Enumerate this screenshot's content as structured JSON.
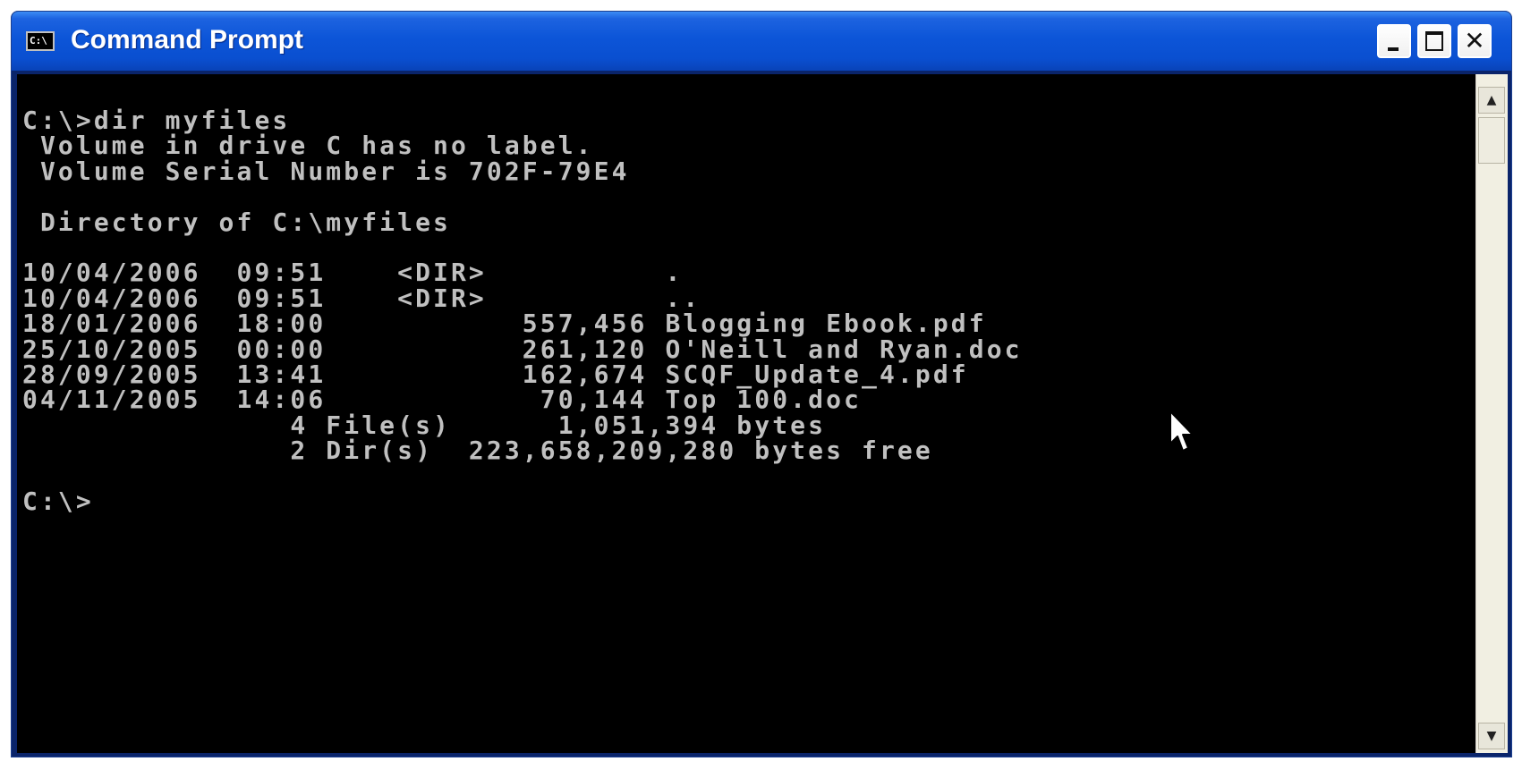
{
  "window": {
    "title": "Command Prompt",
    "icon_text": "C:\\"
  },
  "console": {
    "lines": [
      "C:\\>dir myfiles",
      " Volume in drive C has no label.",
      " Volume Serial Number is 702F-79E4",
      "",
      " Directory of C:\\myfiles",
      "",
      "10/04/2006  09:51    <DIR>          .",
      "10/04/2006  09:51    <DIR>          ..",
      "18/01/2006  18:00           557,456 Blogging Ebook.pdf",
      "25/10/2005  00:00           261,120 O'Neill and Ryan.doc",
      "28/09/2005  13:41           162,674 SCQF_Update_4.pdf",
      "04/11/2005  14:06            70,144 Top 100.doc",
      "               4 File(s)      1,051,394 bytes",
      "               2 Dir(s)  223,658,209,280 bytes free",
      "",
      "C:\\>"
    ]
  },
  "colors": {
    "titlebar": "#0a4fd0",
    "console_bg": "#000000",
    "console_text": "#c0c0c0"
  },
  "icons": {
    "app": "console-icon",
    "minimize": "minimize-icon",
    "maximize": "maximize-icon",
    "close": "close-icon",
    "scroll_up": "arrow-up-icon",
    "scroll_down": "arrow-down-icon",
    "pointer": "mouse-pointer-icon"
  }
}
